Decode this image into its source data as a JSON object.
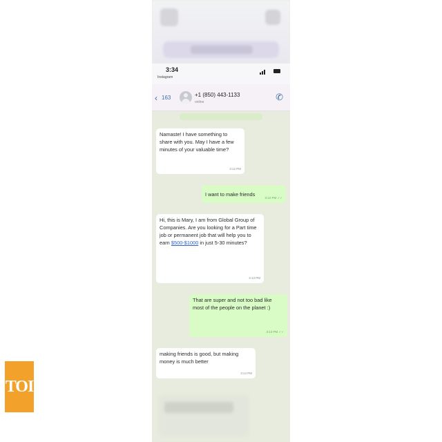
{
  "status": {
    "time": "3:34",
    "carrier": "Instagram"
  },
  "header": {
    "back_glyph": "‹",
    "back_count": "163",
    "contact": "+1 (850) 443-1133",
    "subtitle": "online",
    "call_glyph": "✆"
  },
  "messages": [
    {
      "dir": "in",
      "text": "Namaste! I have something to share with you. May I have a few minutes of your valuable time?",
      "time": "3:12 PM"
    },
    {
      "dir": "out",
      "text": "I want to make friends",
      "time": "3:12 PM ✓✓"
    },
    {
      "dir": "in",
      "pre": "Hi, this is Mary, I am from Global Group of Companies. Are you looking for a Part time job or permanent job that will help you to earn ",
      "link": "$500-$1000",
      "post": " in just 5-30 minutes?",
      "time": "3:13 PM"
    },
    {
      "dir": "out",
      "text": "That are super and not too bad like most of the people on the planet :)",
      "time": "3:13 PM ✓✓"
    },
    {
      "dir": "in",
      "text": "making friends is good, but making money is much better",
      "time": "3:14 PM"
    }
  ],
  "watermark": {
    "text": "TOI",
    "color": "#f2a12a"
  },
  "colors": {
    "incoming": "#ffffff",
    "outgoing": "#d9fcc7",
    "chat_bg": "#e8ecde",
    "accent": "#3b6ea8"
  }
}
